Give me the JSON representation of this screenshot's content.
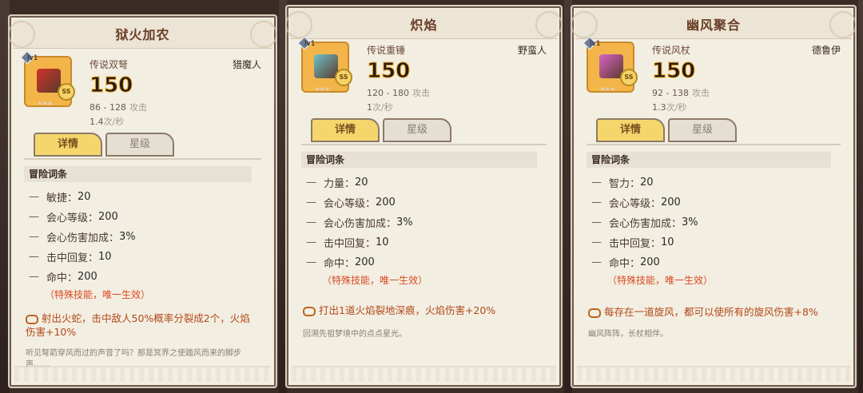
{
  "cards": [
    {
      "title": "狱火加农",
      "weapon_type": "传说双弩",
      "class": "猎魔人",
      "power": "150",
      "level": "lv1",
      "damage": "86 - 128",
      "damage_unit": "攻击",
      "speed": "1.4",
      "speed_unit": "次/秒",
      "stars_filled": 2,
      "tab_active": "详情",
      "tab_idle": "星级",
      "section_title": "冒险词条",
      "attributes": [
        {
          "dash": "—",
          "key": "敏捷：",
          "value": "20"
        },
        {
          "dash": "—",
          "key": "会心等级：",
          "value": "200"
        },
        {
          "dash": "—",
          "key": "会心伤害加成：",
          "value": "3%"
        },
        {
          "dash": "—",
          "key": "击中回复：",
          "value": "10"
        },
        {
          "dash": "—",
          "key": "命中：",
          "value": "200"
        }
      ],
      "special": "（特殊技能，唯一生效）",
      "skill": "射出火蛇，击中敌人50%概率分裂成2个，火焰伤害+10%",
      "flavor": "听见弩箭穿风而过的声音了吗？那是冥界之使踏风而来的脚步声……",
      "accent": "#d2342c"
    },
    {
      "title": "炽焰",
      "weapon_type": "传说重锤",
      "class": "野蛮人",
      "power": "150",
      "level": "lv1",
      "damage": "120 - 180",
      "damage_unit": "攻击",
      "speed": "1",
      "speed_unit": "次/秒",
      "stars_filled": 2,
      "tab_active": "详情",
      "tab_idle": "星级",
      "section_title": "冒险词条",
      "attributes": [
        {
          "dash": "—",
          "key": "力量：",
          "value": "20"
        },
        {
          "dash": "—",
          "key": "会心等级：",
          "value": "200"
        },
        {
          "dash": "—",
          "key": "会心伤害加成：",
          "value": "3%"
        },
        {
          "dash": "—",
          "key": "击中回复：",
          "value": "10"
        },
        {
          "dash": "—",
          "key": "命中：",
          "value": "200"
        }
      ],
      "special": "（特殊技能，唯一生效）",
      "skill": "打出1道火焰裂地深痕，火焰伤害+20%",
      "flavor": "回溯先祖梦境中的点点星光。",
      "accent": "#6fc1cc"
    },
    {
      "title": "幽风聚合",
      "weapon_type": "传说风杖",
      "class": "德鲁伊",
      "power": "150",
      "level": "lv1",
      "damage": "92 - 138",
      "damage_unit": "攻击",
      "speed": "1.3",
      "speed_unit": "次/秒",
      "stars_filled": 2,
      "tab_active": "详情",
      "tab_idle": "星级",
      "section_title": "冒险词条",
      "attributes": [
        {
          "dash": "—",
          "key": "智力：",
          "value": "20"
        },
        {
          "dash": "—",
          "key": "会心等级：",
          "value": "200"
        },
        {
          "dash": "—",
          "key": "会心伤害加成：",
          "value": "3%"
        },
        {
          "dash": "—",
          "key": "击中回复：",
          "value": "10"
        },
        {
          "dash": "—",
          "key": "命中：",
          "value": "200"
        }
      ],
      "special": "（特殊技能，唯一生效）",
      "skill": "每存在一道旋风，都可以使所有的旋风伤害+8%",
      "flavor": "幽风阵阵，长杖相伴。",
      "accent": "#d964c8"
    }
  ]
}
